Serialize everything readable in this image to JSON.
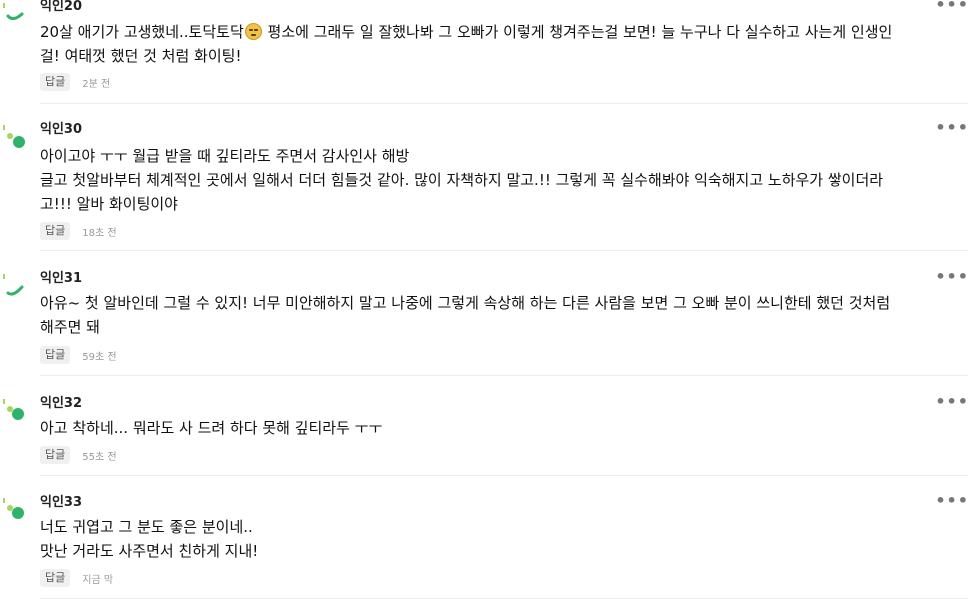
{
  "comments": [
    {
      "author": "익인20",
      "lines": [
        "20살 애기가 고생했네..토닥토닥",
        " 평소에 그래두 일 잘했나봐 그 오빠가 이렇게 챙겨주는걸 보면! 늘 누구나 다 실수하고 사는게 인생인",
        "걸! 여태껏 했던 것 처럼 화이팅!"
      ],
      "reply_label": "답글",
      "time": "2분 전",
      "avatar_icon": "green-swoosh-icon"
    },
    {
      "author": "익인30",
      "lines": [
        "아이고야 ㅜㅜ 월급 받을 때 깊티라도 주면서 감사인사 해방",
        "글고 첫알바부터 체계적인 곳에서 일해서 더더 힘들것 같아. 많이 자책하지 말고.!! 그렇게 꼭 실수해봐야 익숙해지고 노하우가 쌓이더라",
        "고!!! 알바 화이팅이야"
      ],
      "reply_label": "답글",
      "time": "18초 전",
      "avatar_icon": "green-dots-icon"
    },
    {
      "author": "익인31",
      "lines": [
        "아유~ 첫 알바인데 그럴 수 있지! 너무 미안해하지 말고 나중에 그렇게 속상해 하는 다른 사람을 보면 그 오빠 분이 쓰니한테 했던 것처럼",
        "해주면 돼"
      ],
      "reply_label": "답글",
      "time": "59초 전",
      "avatar_icon": "green-swoosh-icon"
    },
    {
      "author": "익인32",
      "lines": [
        "아고 착하네... 뭐라도 사 드려 하다 못해 깊티라두 ㅜㅜ"
      ],
      "reply_label": "답글",
      "time": "55초 전",
      "avatar_icon": "green-dots-icon"
    },
    {
      "author": "익인33",
      "lines": [
        "너도 귀엽고 그 분도 좋은 분이네..",
        "맛난 거라도 사주면서 친하게 지내!"
      ],
      "reply_label": "답글",
      "time": "지금 막",
      "avatar_icon": "green-dots-icon"
    }
  ],
  "more_label": "•••",
  "colors": {
    "accent_green": "#2fb36b",
    "light_green": "#a4d65e"
  }
}
